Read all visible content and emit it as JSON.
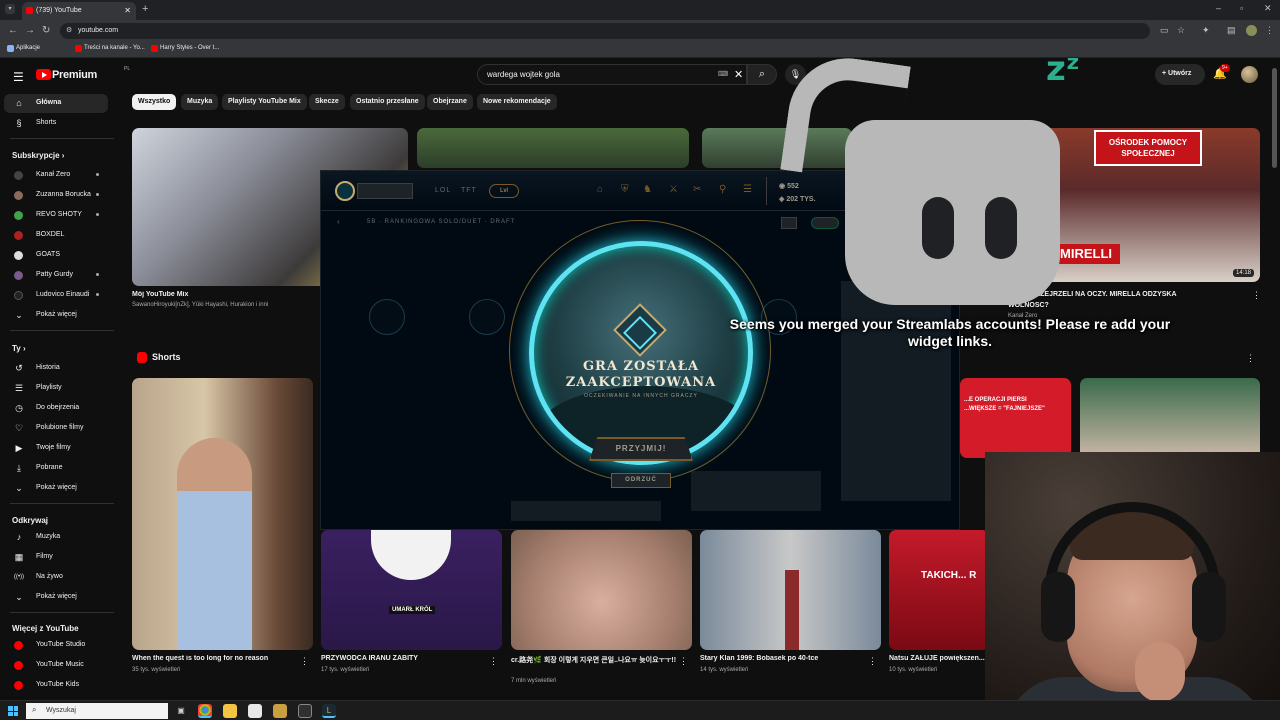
{
  "browser": {
    "tab_title": "(739) YouTube",
    "new_tab": "+",
    "address": "youtube.com",
    "bookmarks": [
      {
        "label": "Aplikacje",
        "color": "#8ab4f8"
      },
      {
        "label": "Treści na kanale - Yo...",
        "color": "#ff0000"
      },
      {
        "label": "Harry Styles - Over t...",
        "color": "#ff0000"
      }
    ]
  },
  "youtube": {
    "logo_text": "Premium",
    "logo_sup": "PL",
    "search_value": "wardega wojtek gola",
    "create_label": "Utwórz",
    "notif_badge": "9+",
    "chips": [
      "Wszystko",
      "Muzyka",
      "Playlisty YouTube Mix",
      "Skecze",
      "Ostatnio przesłane",
      "Obejrzane",
      "Nowe rekomendacje"
    ],
    "sidebar": {
      "main": [
        {
          "label": "Główna",
          "icon": "home-icon",
          "glyph": "⌂"
        },
        {
          "label": "Shorts",
          "icon": "shorts-icon",
          "glyph": "§"
        }
      ],
      "subs_header": "Subskrypcje",
      "subs": [
        {
          "label": "Kanał Zero",
          "color": "#444444",
          "live": true
        },
        {
          "label": "Zuzanna Borucka",
          "color": "#8a6a5a",
          "live": true
        },
        {
          "label": "REVO SHOTY",
          "color": "#3fa34d",
          "live": true
        },
        {
          "label": "BOXDEL",
          "color": "#aa2222",
          "live": false
        },
        {
          "label": "GOATS",
          "color": "#dddddd",
          "live": false
        },
        {
          "label": "Patty Gurdy",
          "color": "#7a5a8a",
          "live": true
        },
        {
          "label": "Ludovico Einaudi",
          "color": "#222222",
          "live": true
        }
      ],
      "show_more": "Pokaż więcej",
      "you_header": "Ty",
      "you": [
        {
          "label": "Historia",
          "icon": "history-icon",
          "glyph": "↺"
        },
        {
          "label": "Playlisty",
          "icon": "playlists-icon",
          "glyph": "☰"
        },
        {
          "label": "Do obejrzenia",
          "icon": "watch-later-icon",
          "glyph": "◷"
        },
        {
          "label": "Polubione filmy",
          "icon": "liked-icon",
          "glyph": "👍"
        },
        {
          "label": "Twoje filmy",
          "icon": "your-videos-icon",
          "glyph": "▶"
        },
        {
          "label": "Pobrane",
          "icon": "downloads-icon",
          "glyph": "⤓"
        }
      ],
      "explore_header": "Odkrywaj",
      "explore": [
        {
          "label": "Muzyka",
          "icon": "music-icon",
          "glyph": "♪"
        },
        {
          "label": "Filmy",
          "icon": "movies-icon",
          "glyph": "▦"
        },
        {
          "label": "Na żywo",
          "icon": "live-icon",
          "glyph": "((•))"
        }
      ],
      "more_header": "Więcej z YouTube",
      "more": [
        {
          "label": "YouTube Studio",
          "color": "#ff0000"
        },
        {
          "label": "YouTube Music",
          "color": "#ff0000"
        },
        {
          "label": "YouTube Kids",
          "color": "#ff0000"
        }
      ]
    },
    "videos": [
      {
        "title": "Mój YouTube Mix",
        "meta": "SawanoHiroyuki[nZk], Yūki Hayashi, Hurakion i inni"
      },
      {
        "title": "...NCY PRZEJRZELI NA OCZY. MIRELLA ODZYSKA",
        "title2": "WOLNOŚĆ?",
        "meta": "Kanał Zero",
        "duration": "14:18",
        "overlay": "OŚRODEK POMOCY SPOŁECZNEJ",
        "overlay2": "MIRELLI"
      }
    ],
    "shorts_header": "Shorts",
    "shorts": [
      {
        "title": "When the quest is too long for no reason",
        "meta": "35 tys. wyświetleń"
      },
      {
        "title": "PRZYWÓDCA IRANU ZABITY",
        "meta": "17 tys. wyświetleń",
        "caption": "UMARŁ KRÓL"
      },
      {
        "title": "cr.路尧🌿 회장 이렇게 지우면 큰일..나요ㅠ 늦이요ㅜㅜ!!",
        "meta": "7 mln wyświetleń"
      },
      {
        "title": "Stary Klan 1999: Bobasek po 40-tce",
        "meta": "14 tys. wyświetleń"
      },
      {
        "title": "Natsu ŻAŁUJE powiększen...",
        "meta": "10 tys. wyświetleń",
        "caption": "TAKICH... R"
      }
    ],
    "short_overlay": "...E OPERACJI PIERSI\n...WIĘKSZE = \"FAJNIEJSZE\""
  },
  "lol": {
    "tabs": [
      "LOL",
      "TFT"
    ],
    "mode_badge": "Lvl",
    "rp": "552",
    "be": "202 TYS.",
    "queue": "5B · RANKINGOWA SOLO/DUET · DRAFT",
    "accepted_line1": "GRA ZOSTAŁA",
    "accepted_line2": "ZAAKCEPTOWANA",
    "waiting": "OCZEKIWANIE NA INNYCH GRACZY",
    "accept_label": "PRZYJMIJ!",
    "decline_label": "ODRZUĆ"
  },
  "streamlabs": {
    "zz": "zᶻ",
    "message": "Seems you merged your Streamlabs accounts! Please re add your widget links."
  },
  "taskbar": {
    "search_label": "Wyszukaj"
  }
}
